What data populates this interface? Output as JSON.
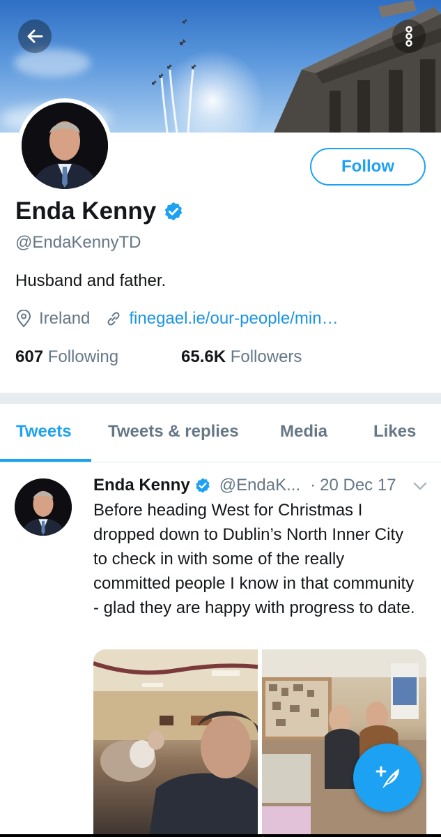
{
  "colors": {
    "accent": "#1da1f2",
    "link": "#1b95e0",
    "secondary_text": "#657786",
    "primary_text": "#14171a",
    "separator": "#e6ecf0"
  },
  "header": {
    "back_icon": "arrow-left-icon",
    "more_icon": "more-vertical-icon"
  },
  "profile": {
    "name": "Enda Kenny",
    "handle": "@EndaKennyTD",
    "bio": "Husband and father.",
    "location": "Ireland",
    "website": "finegael.ie/our-people/min…",
    "following_count": "607",
    "following_label": "Following",
    "followers_count": "65.6K",
    "followers_label": "Followers",
    "follow_label": "Follow",
    "verified_icon": "verified-badge-icon",
    "location_icon": "location-pin-icon",
    "link_icon": "link-icon"
  },
  "tabs": [
    {
      "label": "Tweets",
      "active": true
    },
    {
      "label": "Tweets & replies",
      "active": false
    },
    {
      "label": "Media",
      "active": false
    },
    {
      "label": "Likes",
      "active": false
    }
  ],
  "tweet": {
    "author_name": "Enda Kenny",
    "author_handle": "@EndaK...",
    "separator": "·",
    "date": "20 Dec 17",
    "text": "Before heading West for Christmas I dropped down to Dublin’s North Inner City to check in with some of the really committed people I know in that community - glad they are happy with progress to date.",
    "caret_icon": "chevron-down-icon"
  },
  "fab": {
    "icon": "compose-tweet-icon"
  }
}
